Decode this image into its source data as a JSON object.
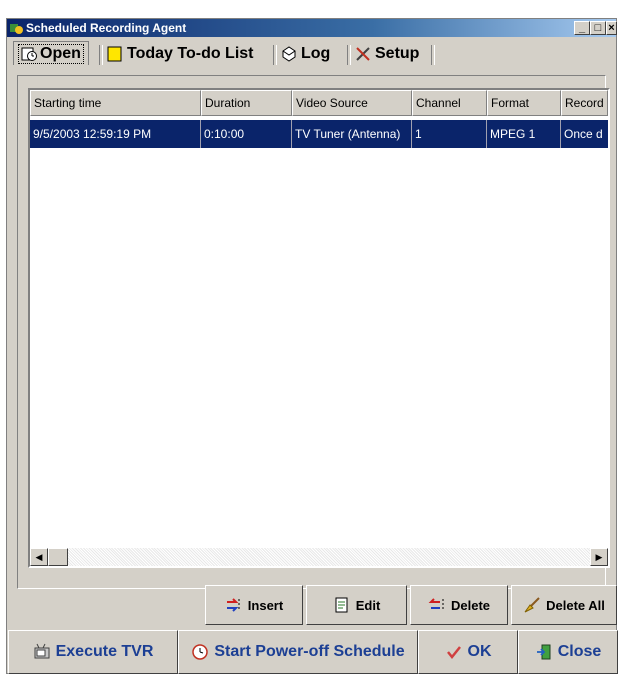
{
  "window": {
    "title": "Scheduled Recording Agent"
  },
  "tabs": [
    {
      "label": "Open",
      "icon": "clock-calendar-icon"
    },
    {
      "label": "Today To-do List",
      "icon": "yellow-note-icon"
    },
    {
      "label": "Log",
      "icon": "log-book-icon"
    },
    {
      "label": "Setup",
      "icon": "tools-icon"
    }
  ],
  "table": {
    "columns": [
      "Starting time",
      "Duration",
      "Video Source",
      "Channel",
      "Format",
      "Record"
    ],
    "rows": [
      [
        "9/5/2003 12:59:19 PM",
        "0:10:00",
        "TV Tuner (Antenna)",
        "1",
        "MPEG 1",
        "Once d"
      ]
    ]
  },
  "actions": {
    "insert": "Insert",
    "edit": "Edit",
    "delete": "Delete",
    "delete_all": "Delete All"
  },
  "footer": {
    "execute": "Execute TVR",
    "power_off": "Start Power-off Schedule",
    "ok": "OK",
    "close": "Close"
  },
  "colors": {
    "selection": "#0a246a",
    "titlebar": "#0a246a",
    "face": "#d4d0c8",
    "footer_text": "#1c3f94"
  }
}
